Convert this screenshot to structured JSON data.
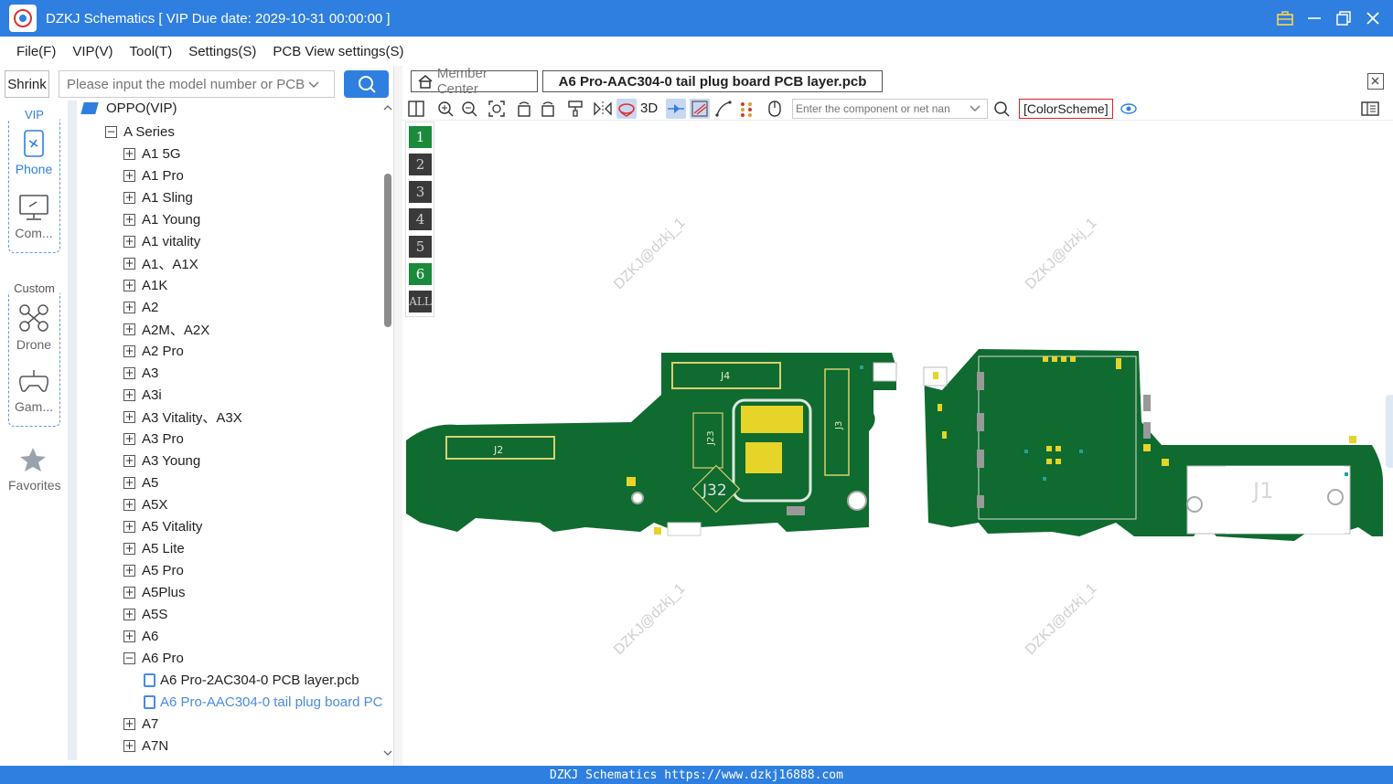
{
  "window": {
    "title": "DZKJ Schematics [ VIP Due date: 2029-10-31 00:00:00 ]"
  },
  "menu": [
    "File(F)",
    "VIP(V)",
    "Tool(T)",
    "Settings(S)",
    "PCB View settings(S)"
  ],
  "sidebar": {
    "shrink_label": "Shrink",
    "search_placeholder": "Please input the model number or PCB",
    "vip_caption": "VIP",
    "custom_caption": "Custom",
    "items": {
      "phone": "Phone",
      "computer": "Com...",
      "drone": "Drone",
      "game": "Gam...",
      "favorites": "Favorites"
    }
  },
  "tree": {
    "root": "OPPO(VIP)",
    "series": "A Series",
    "models_before": [
      "A1 5G",
      "A1 Pro",
      "A1 Sling",
      "A1 Young",
      "A1 vitality",
      "A1、A1X",
      "A1K",
      "A2",
      "A2M、A2X",
      "A2 Pro",
      "A3",
      "A3i",
      "A3 Vitality、A3X",
      "A3 Pro",
      "A3 Young",
      "A5",
      "A5X",
      "A5 Vitality",
      "A5 Lite",
      "A5 Pro",
      "A5Plus",
      "A5S",
      "A6"
    ],
    "expanded_model": "A6 Pro",
    "files": [
      "A6 Pro-2AC304-0 PCB layer.pcb",
      "A6 Pro-AAC304-0 tail plug board PC"
    ],
    "models_after": [
      "A7",
      "A7N"
    ]
  },
  "tabs": {
    "member": "Member Center",
    "active": "A6 Pro-AAC304-0 tail plug board PCB layer.pcb"
  },
  "toolbar": {
    "three_d": "3D",
    "component_placeholder": "Enter the component or net nan",
    "color_scheme": "[ColorScheme]"
  },
  "layers": [
    "1",
    "2",
    "3",
    "4",
    "5",
    "6",
    "ALL"
  ],
  "watermark": "DZKJ@dzkj_1",
  "pcb_labels": [
    "J4",
    "J2",
    "J23",
    "J3",
    "J32",
    "J1"
  ],
  "status": "DZKJ Schematics https://www.dzkj16888.com"
}
